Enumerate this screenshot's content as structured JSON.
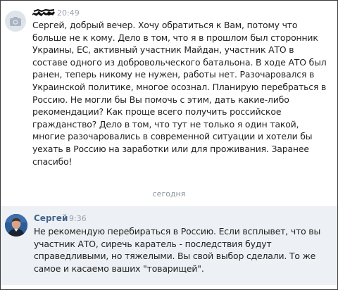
{
  "conversation": {
    "messages": [
      {
        "sender": "",
        "time": "20:49",
        "text": "Сергей, добрый вечер. Хочу обратиться к Вам, потому что больше не к кому. Дело в том, что я в прошлом был сторонник Украины, ЕС, активный участник Майдан, участник АТО в составе одного из добровольческого батальона. В ходе АТО был ранен, теперь никому не нужен, работы нет. Разочаровался в Украинской политике, многое осознал. Планирую перебраться в Россию. Не могли бы Вы помочь с этим, дать какие-либо рекомендации? Как проще всего получить российское гражданство? Дело в том, что тут не только я один такой, многие разочаровались в современной ситуации и хотели бы уехать в Россию на заработки или для проживания. Заранее спасибо!"
      },
      {
        "sender": "Сергей",
        "time": "9:36",
        "text": "Не рекомендую перебираться в Россию. Если всплывет, что вы участник АТО, сиречь каратель - последствия будут справедливыми, но тяжелыми. Вы свой выбор сделали. То же самое и касаемо ваших \"товарищей\"."
      }
    ],
    "date_divider": "сегодня"
  },
  "icons": {
    "avatar_1": "camera-icon",
    "avatar_2": "user-avatar"
  },
  "colors": {
    "sender_name": "#42648b",
    "timestamp": "#9aa4b0",
    "highlight_bg": "#edf0f4"
  }
}
